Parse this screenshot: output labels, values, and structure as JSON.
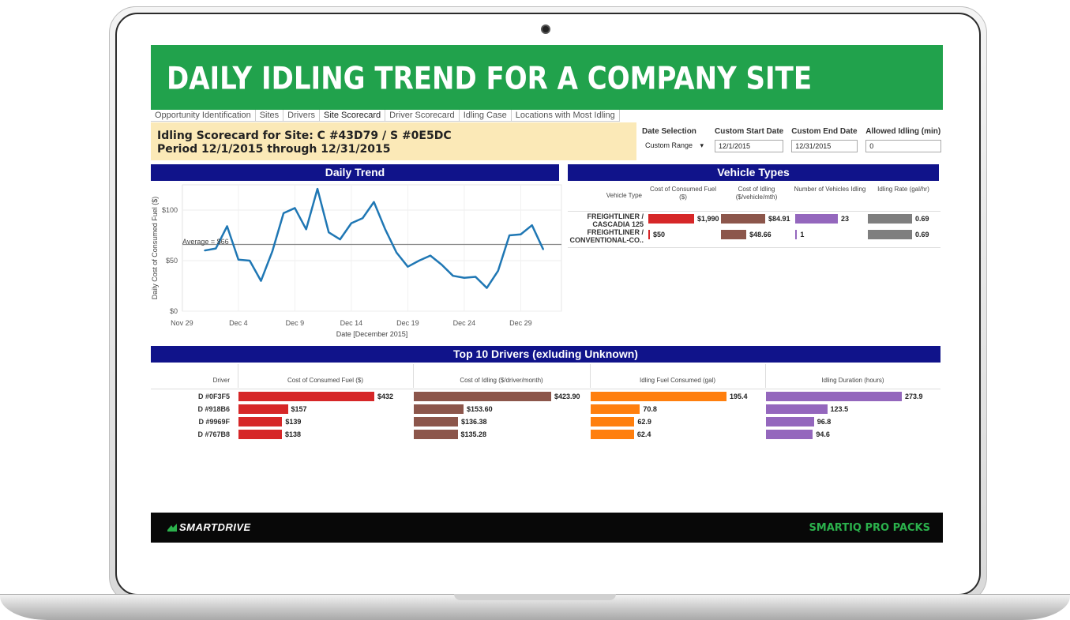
{
  "banner": {
    "title": "DAILY IDLING TREND FOR A COMPANY SITE"
  },
  "tabs": [
    {
      "label": "Opportunity Identification"
    },
    {
      "label": "Sites"
    },
    {
      "label": "Drivers"
    },
    {
      "label": "Site Scorecard",
      "active": true
    },
    {
      "label": "Driver Scorecard"
    },
    {
      "label": "Idling Case"
    },
    {
      "label": "Locations with Most Idling"
    }
  ],
  "scorecard": {
    "line1": "Idling Scorecard for Site: C #43D79 / S #0E5DC",
    "line2": "Period 12/1/2015 through 12/31/2015"
  },
  "filters": {
    "date_selection": {
      "label": "Date Selection",
      "value": "Custom Range"
    },
    "start_date": {
      "label": "Custom Start Date",
      "value": "12/1/2015"
    },
    "end_date": {
      "label": "Custom End Date",
      "value": "12/31/2015"
    },
    "allowed_idling": {
      "label": "Allowed Idling (min)",
      "value": "0"
    }
  },
  "daily_trend": {
    "title": "Daily Trend",
    "average_label": "Average = $66"
  },
  "vehicle_types": {
    "title": "Vehicle Types",
    "headers": [
      "Vehicle Type",
      "Cost of Consumed Fuel ($)",
      "Cost of Idling ($/vehicle/mth)",
      "Number of Vehicles Idling",
      "Idling Rate (gal/hr)"
    ],
    "rows": [
      {
        "type_line1": "FREIGHTLINER /",
        "type_line2": "CASCADIA 125",
        "cost_fuel": "$1,990",
        "cost_idling": "$84.91",
        "num_vehicles": "23",
        "idling_rate": "0.69"
      },
      {
        "type_line1": "FREIGHTLINER /",
        "type_line2": "CONVENTIONAL-CO..",
        "cost_fuel": "$50",
        "cost_idling": "$48.66",
        "num_vehicles": "1",
        "idling_rate": "0.69"
      }
    ]
  },
  "top_drivers": {
    "title": "Top 10 Drivers (exluding Unknown)",
    "headers": [
      "Driver",
      "Cost of Consumed Fuel ($)",
      "Cost of Idling ($/driver/month)",
      "Idling Fuel Consumed (gal)",
      "Idling Duration (hours)"
    ],
    "rows": [
      {
        "driver": "D #0F3F5",
        "cost_fuel": "$432",
        "cost_idling": "$423.90",
        "fuel_gal": "195.4",
        "duration": "273.9"
      },
      {
        "driver": "D #918B6",
        "cost_fuel": "$157",
        "cost_idling": "$153.60",
        "fuel_gal": "70.8",
        "duration": "123.5"
      },
      {
        "driver": "D #9969F",
        "cost_fuel": "$139",
        "cost_idling": "$136.38",
        "fuel_gal": "62.9",
        "duration": "96.8"
      },
      {
        "driver": "D #767B8",
        "cost_fuel": "$138",
        "cost_idling": "$135.28",
        "fuel_gal": "62.4",
        "duration": "94.6"
      }
    ]
  },
  "footer": {
    "logo": "SMARTDRIVE",
    "product": "SMARTIQ PRO PACKS"
  },
  "colors": {
    "banner": "#21a24c",
    "section": "#10138a",
    "line": "#1f77b4",
    "red": "#d62728",
    "brown": "#8c564b",
    "purple": "#9467bd",
    "gray": "#7f7f7f",
    "orange": "#ff7f0e"
  },
  "chart_data": [
    {
      "type": "line",
      "title": "Daily Trend",
      "xlabel": "Date [December 2015]",
      "ylabel": "Daily Cost of Consumed Fuel ($)",
      "x_ticks": [
        "Nov 29",
        "Dec 4",
        "Dec 9",
        "Dec 14",
        "Dec 19",
        "Dec 24",
        "Dec 29"
      ],
      "y_ticks": [
        "$0",
        "$50",
        "$100"
      ],
      "ylim": [
        0,
        125
      ],
      "average": 66,
      "x": [
        "Dec 1",
        "Dec 2",
        "Dec 3",
        "Dec 4",
        "Dec 5",
        "Dec 6",
        "Dec 7",
        "Dec 8",
        "Dec 9",
        "Dec 10",
        "Dec 11",
        "Dec 12",
        "Dec 13",
        "Dec 14",
        "Dec 15",
        "Dec 16",
        "Dec 17",
        "Dec 18",
        "Dec 19",
        "Dec 20",
        "Dec 21",
        "Dec 22",
        "Dec 23",
        "Dec 24",
        "Dec 25",
        "Dec 26",
        "Dec 27",
        "Dec 28",
        "Dec 29",
        "Dec 30",
        "Dec 31"
      ],
      "values": [
        60,
        62,
        84,
        51,
        50,
        30,
        59,
        97,
        102,
        81,
        121,
        78,
        71,
        87,
        92,
        108,
        81,
        58,
        44,
        50,
        55,
        46,
        35,
        33,
        34,
        23,
        40,
        75,
        76,
        85,
        61
      ],
      "grid": true
    },
    {
      "type": "bar",
      "title": "Vehicle Types",
      "categories": [
        "FREIGHTLINER / CASCADIA 125",
        "FREIGHTLINER / CONVENTIONAL-CO.."
      ],
      "series": [
        {
          "name": "Cost of Consumed Fuel ($)",
          "values": [
            1990,
            50
          ]
        },
        {
          "name": "Cost of Idling ($/vehicle/mth)",
          "values": [
            84.91,
            48.66
          ]
        },
        {
          "name": "Number of Vehicles Idling",
          "values": [
            23,
            1
          ]
        },
        {
          "name": "Idling Rate (gal/hr)",
          "values": [
            0.69,
            0.69
          ]
        }
      ]
    },
    {
      "type": "bar",
      "title": "Top 10 Drivers (exluding Unknown)",
      "categories": [
        "D #0F3F5",
        "D #918B6",
        "D #9969F",
        "D #767B8"
      ],
      "series": [
        {
          "name": "Cost of Consumed Fuel ($)",
          "values": [
            432,
            157,
            139,
            138
          ]
        },
        {
          "name": "Cost of Idling ($/driver/month)",
          "values": [
            423.9,
            153.6,
            136.38,
            135.28
          ]
        },
        {
          "name": "Idling Fuel Consumed (gal)",
          "values": [
            195.4,
            70.8,
            62.9,
            62.4
          ]
        },
        {
          "name": "Idling Duration (hours)",
          "values": [
            273.9,
            123.5,
            96.8,
            94.6
          ]
        }
      ]
    }
  ]
}
